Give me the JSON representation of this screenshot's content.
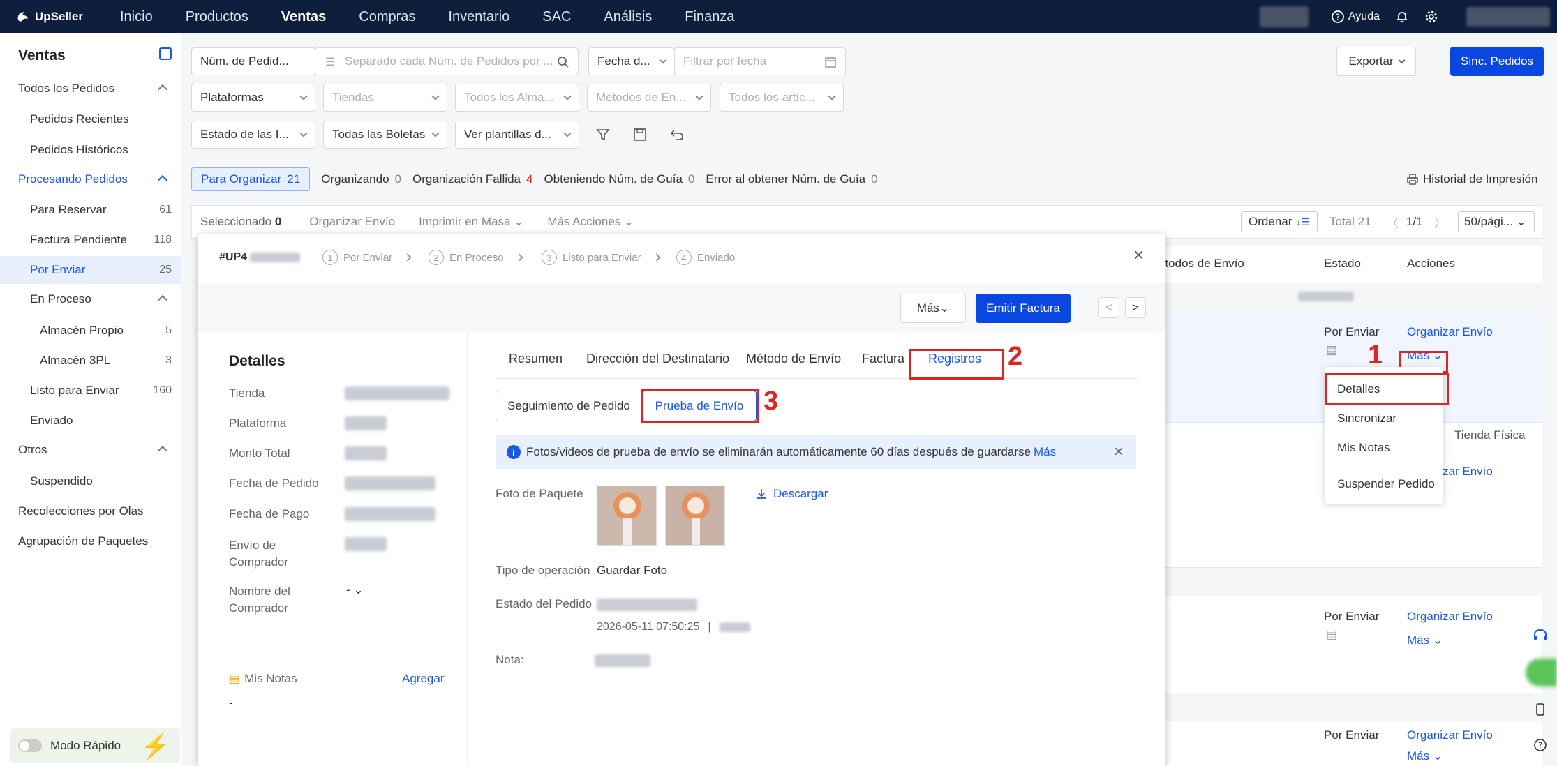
{
  "topnav": {
    "brand": "UpSeller",
    "items": [
      "Inicio",
      "Productos",
      "Ventas",
      "Compras",
      "Inventario",
      "SAC",
      "Análisis",
      "Finanza"
    ],
    "active": "Ventas",
    "help": "Ayuda"
  },
  "sidebar": {
    "title": "Ventas",
    "items": [
      {
        "label": "Todos los Pedidos",
        "count": ""
      },
      {
        "label": "Pedidos Recientes",
        "count": ""
      },
      {
        "label": "Pedidos Históricos",
        "count": ""
      },
      {
        "label": "Procesando Pedidos",
        "count": ""
      },
      {
        "label": "Para Reservar",
        "count": "61"
      },
      {
        "label": "Factura Pendiente",
        "count": "118"
      },
      {
        "label": "Por Enviar",
        "count": "25"
      },
      {
        "label": "En Proceso",
        "count": ""
      },
      {
        "label": "Almacén Propio",
        "count": "5"
      },
      {
        "label": "Almacén 3PL",
        "count": "3"
      },
      {
        "label": "Listo para Enviar",
        "count": "160"
      },
      {
        "label": "Enviado",
        "count": ""
      },
      {
        "label": "Otros",
        "count": ""
      },
      {
        "label": "Suspendido",
        "count": ""
      },
      {
        "label": "Recolecciones por Olas",
        "count": ""
      },
      {
        "label": "Agrupación de Paquetes",
        "count": ""
      }
    ],
    "quick_mode": "Modo Rápido"
  },
  "filters": {
    "order_num": "Núm. de Pedid...",
    "order_search_ph": "Separado cada Núm. de Pedidos por ...",
    "date_type": "Fecha d...",
    "date_ph": "Filtrar por fecha",
    "platforms": "Plataformas",
    "stores": "Tiendas",
    "warehouses": "Todos los Alma...",
    "ship_methods": "Métodos de En...",
    "articles": "Todos los artíc...",
    "status": "Estado de las I...",
    "invoices": "Todas las Boletas",
    "templates": "Ver plantillas d...",
    "export": "Exportar",
    "sync": "Sinc. Pedidos"
  },
  "status_tabs": [
    {
      "label": "Para Organizar",
      "count": "21"
    },
    {
      "label": "Organizando",
      "count": "0"
    },
    {
      "label": "Organización Fallida",
      "count": "4"
    },
    {
      "label": "Obteniendo Núm. de Guía",
      "count": "0"
    },
    {
      "label": "Error al obtener Núm. de Guía",
      "count": "0"
    }
  ],
  "print_history": "Historial de Impresión",
  "actionbar": {
    "selected_label": "Seleccionado",
    "selected_count": "0",
    "organize": "Organizar Envío",
    "bulk_print": "Imprimir en Masa",
    "more_actions": "Más Acciones",
    "sort": "Ordenar",
    "total": "Total 21",
    "page": "1/1",
    "per_page": "50/pági..."
  },
  "table": {
    "col_ship": "étodos de Envío",
    "col_status": "Estado",
    "col_actions": "Acciones",
    "row_status": "Por Enviar",
    "action_organize": "Organizar Envío",
    "action_more": "Más",
    "store_type": "Tienda Física"
  },
  "modal": {
    "order_id": "#UP4",
    "steps": [
      "Por Enviar",
      "En Proceso",
      "Listo para Enviar",
      "Enviado"
    ],
    "more": "Más",
    "emit_invoice": "Emitir Factura",
    "details_title": "Detalles",
    "detail_labels": [
      "Tienda",
      "Plataforma",
      "Monto Total",
      "Fecha de Pedido",
      "Fecha de Pago",
      "Envío de Comprador",
      "Nombre del Comprador"
    ],
    "buyer_name_value": "-",
    "notes_label": "Mis Notas",
    "notes_add": "Agregar",
    "notes_value": "-",
    "tabs": [
      "Resumen",
      "Dirección del Destinatario",
      "Método de Envío",
      "Factura",
      "Registros"
    ],
    "subtabs": [
      "Seguimiento de Pedido",
      "Prueba de Envío"
    ],
    "info_text": "Fotos/videos de prueba de envío se eliminarán automáticamente 60 días después de guardarse",
    "info_more": "Más",
    "photo_label": "Foto de Paquete",
    "download": "Descargar",
    "op_type_label": "Tipo de operación",
    "op_type_value": "Guardar Foto",
    "order_status_label": "Estado del Pedido",
    "status_time": "2026-05-11 07:50:25",
    "note_label": "Nota:"
  },
  "menu": {
    "items": [
      "Detalles",
      "Sincronizar",
      "Mis Notas",
      "Suspender Pedido"
    ]
  },
  "annotations": [
    "1",
    "2",
    "3"
  ]
}
